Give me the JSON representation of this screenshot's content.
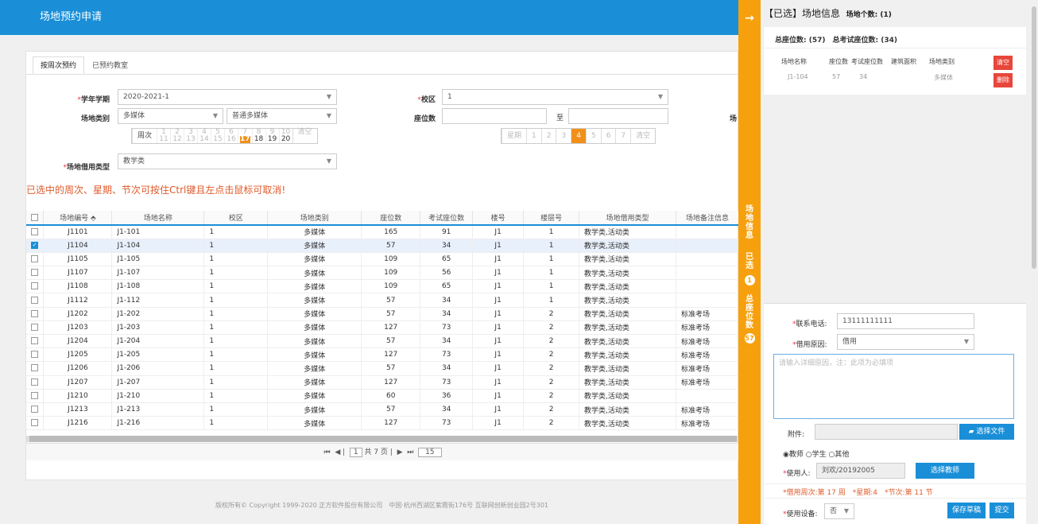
{
  "header": {
    "title": "场地预约申请"
  },
  "tabs": [
    "按周次预约",
    "已预约教室"
  ],
  "form": {
    "year_label": "学年学期",
    "year_value": "2020-2021-1",
    "campus_label": "校区",
    "campus_value": "1",
    "type_label": "场地类别",
    "type_value1": "多媒体",
    "type_value2": "普通多媒体",
    "seat_label": "座位数",
    "seat_to": "至",
    "cut_label": "场",
    "week_label": "周次",
    "weeks_top": [
      "1",
      "2",
      "3",
      "4",
      "5",
      "6",
      "7",
      "8",
      "9",
      "10"
    ],
    "weeks_bottom": [
      "11",
      "12",
      "13",
      "14",
      "15",
      "16",
      "17",
      "18",
      "19",
      "20"
    ],
    "week_clear": "清空",
    "day_label": "星期",
    "days": [
      "1",
      "2",
      "3",
      "4",
      "5",
      "6",
      "7"
    ],
    "day_clear": "清空",
    "borrow_type_label": "场地借用类型",
    "borrow_type_value": "教学类",
    "required": "*"
  },
  "notice": "已选中的周次、星期、节次可按住Ctrl键且左点击鼠标可取消!",
  "table": {
    "headers": [
      "场地编号 ⬘",
      "场地名称",
      "校区",
      "场地类别",
      "座位数",
      "考试座位数",
      "楼号",
      "楼层号",
      "场地借用类型",
      "场地备注信息"
    ],
    "rows": [
      {
        "checked": false,
        "cells": [
          "J1101",
          "J1-101",
          "1",
          "多媒体",
          "165",
          "91",
          "J1",
          "1",
          "教学类,活动类",
          ""
        ]
      },
      {
        "checked": true,
        "cells": [
          "J1104",
          "J1-104",
          "1",
          "多媒体",
          "57",
          "34",
          "J1",
          "1",
          "教学类,活动类",
          ""
        ]
      },
      {
        "checked": false,
        "cells": [
          "J1105",
          "J1-105",
          "1",
          "多媒体",
          "109",
          "65",
          "J1",
          "1",
          "教学类,活动类",
          ""
        ]
      },
      {
        "checked": false,
        "cells": [
          "J1107",
          "J1-107",
          "1",
          "多媒体",
          "109",
          "56",
          "J1",
          "1",
          "教学类,活动类",
          ""
        ]
      },
      {
        "checked": false,
        "cells": [
          "J1108",
          "J1-108",
          "1",
          "多媒体",
          "109",
          "65",
          "J1",
          "1",
          "教学类,活动类",
          ""
        ]
      },
      {
        "checked": false,
        "cells": [
          "J1112",
          "J1-112",
          "1",
          "多媒体",
          "57",
          "34",
          "J1",
          "1",
          "教学类,活动类",
          ""
        ]
      },
      {
        "checked": false,
        "cells": [
          "J1202",
          "J1-202",
          "1",
          "多媒体",
          "57",
          "34",
          "J1",
          "2",
          "教学类,活动类",
          "标准考场"
        ]
      },
      {
        "checked": false,
        "cells": [
          "J1203",
          "J1-203",
          "1",
          "多媒体",
          "127",
          "73",
          "J1",
          "2",
          "教学类,活动类",
          "标准考场"
        ]
      },
      {
        "checked": false,
        "cells": [
          "J1204",
          "J1-204",
          "1",
          "多媒体",
          "57",
          "34",
          "J1",
          "2",
          "教学类,活动类",
          "标准考场"
        ]
      },
      {
        "checked": false,
        "cells": [
          "J1205",
          "J1-205",
          "1",
          "多媒体",
          "127",
          "73",
          "J1",
          "2",
          "教学类,活动类",
          "标准考场"
        ]
      },
      {
        "checked": false,
        "cells": [
          "J1206",
          "J1-206",
          "1",
          "多媒体",
          "57",
          "34",
          "J1",
          "2",
          "教学类,活动类",
          "标准考场"
        ]
      },
      {
        "checked": false,
        "cells": [
          "J1207",
          "J1-207",
          "1",
          "多媒体",
          "127",
          "73",
          "J1",
          "2",
          "教学类,活动类",
          "标准考场"
        ]
      },
      {
        "checked": false,
        "cells": [
          "J1210",
          "J1-210",
          "1",
          "多媒体",
          "60",
          "36",
          "J1",
          "2",
          "教学类,活动类",
          ""
        ]
      },
      {
        "checked": false,
        "cells": [
          "J1213",
          "J1-213",
          "1",
          "多媒体",
          "57",
          "34",
          "J1",
          "2",
          "教学类,活动类",
          "标准考场"
        ]
      },
      {
        "checked": false,
        "cells": [
          "J1216",
          "J1-216",
          "1",
          "多媒体",
          "127",
          "73",
          "J1",
          "2",
          "教学类,活动类",
          "标准考场"
        ]
      }
    ]
  },
  "pagination": {
    "page": "1",
    "total": "共 7 页",
    "size": "15"
  },
  "footer": "版权所有© Copyright 1999-2020 正方软件股份有限公司　中国·杭州西湖区紫霞街176号 互联网创新创业园2号301",
  "side": {
    "text1": "场地信息",
    "text2": "已选",
    "count1": "1",
    "text3": "总座位数",
    "count2": "57"
  },
  "selected": {
    "title": "【已选】场地信息",
    "count_label": "场地个数: (1)",
    "totals": "总座位数: (57)　总考试座位数: (34)",
    "headers": [
      "场地名称",
      "座位数",
      "考试座位数",
      "建筑面积",
      "场地类别"
    ],
    "row": [
      "J1-104",
      "57",
      "34",
      "",
      "多媒体"
    ],
    "clear": "清空",
    "delete": "删除"
  },
  "apply": {
    "phone_label": "联系电话:",
    "phone_value": "13111111111",
    "reason_label": "借用原因:",
    "reason_value": "借用",
    "detail_placeholder": "请输入详细原因，注：此项为必填项",
    "attach_label": "附件:",
    "attach_btn": "选择文件",
    "radio_teacher": "教师",
    "radio_student": "学生",
    "radio_other": "其他",
    "user_label": "使用人:",
    "user_value": "刘欢/20192005",
    "select_teacher": "选择教师",
    "summary": "*借用周次:第 17 周　*星期:4　*节次:第 11 节",
    "device_label": "使用设备:",
    "device_value": "否",
    "save": "保存草稿",
    "submit": "提交",
    "required": "*"
  }
}
